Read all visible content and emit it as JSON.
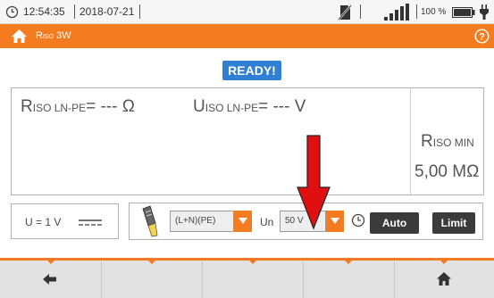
{
  "status": {
    "time": "12:54:35",
    "date": "2018-07-21",
    "battery_percent": "100 %"
  },
  "title": {
    "main": "R",
    "sub": "ISO",
    "suffix": " 3W"
  },
  "ready_label": "READY!",
  "readings": {
    "riso_main": "R",
    "riso_sub": "ISO LN-PE",
    "riso_value": "= --- Ω",
    "uiso_main": "U",
    "uiso_sub": "ISO LN-PE",
    "uiso_value": "= --- V",
    "limit_main": "R",
    "limit_sub": "ISO MIN",
    "limit_value": "5,00 MΩ"
  },
  "voltage_box": "U = 1 V",
  "controls": {
    "config_value": "(L+N)(PE)",
    "un_label": "Un",
    "un_value": "50 V",
    "auto_label": "Auto",
    "limit_label": "Limit"
  },
  "colors": {
    "accent": "#f47b20",
    "ready": "#2f7fd4",
    "arrow": "#e01010"
  }
}
